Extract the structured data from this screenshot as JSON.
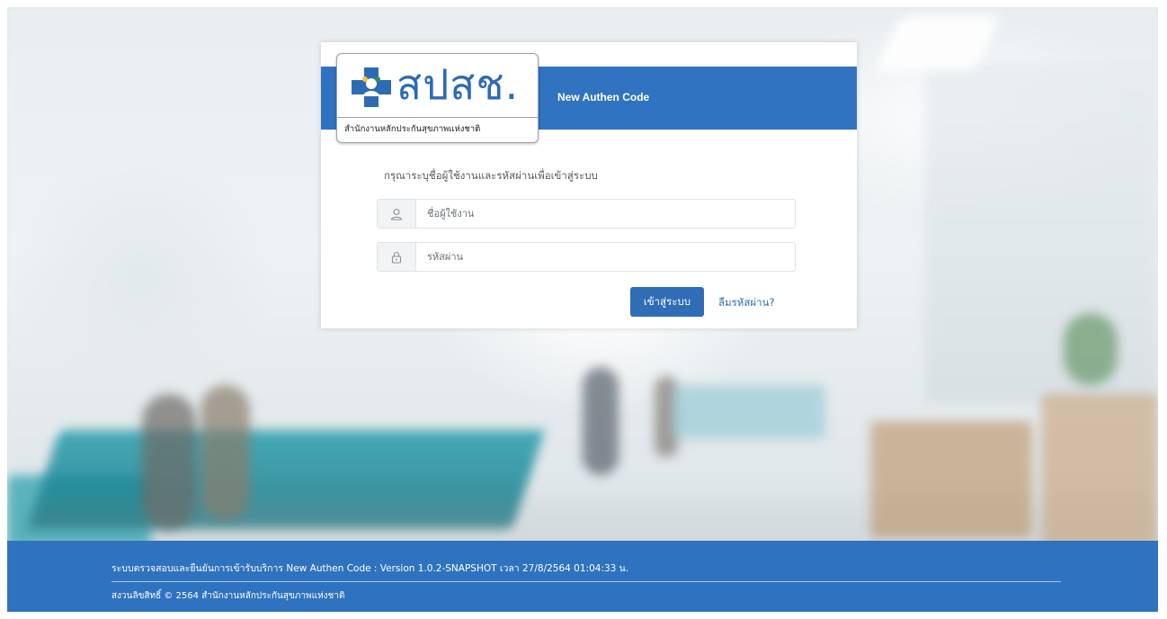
{
  "header": {
    "title": "New Authen Code"
  },
  "logo": {
    "wordmark": "สปสช.",
    "subtitle": "สำนักงานหลักประกันสุขภาพแห่งชาติ",
    "icon": "nhso-cross-icon",
    "brand_color": "#2d6bb5"
  },
  "login": {
    "prompt": "กรุณาระบุชื่อผู้ใช้งานและรหัสผ่านเพื่อเข้าสู่ระบบ",
    "username": {
      "placeholder": "ชื่อผู้ใช้งาน",
      "value": "",
      "icon": "user-icon"
    },
    "password": {
      "placeholder": "รหัสผ่าน",
      "value": "",
      "icon": "lock-icon"
    },
    "submit_label": "เข้าสู่ระบบ",
    "forgot_label": "ลืมรหัสผ่าน?"
  },
  "footer": {
    "line1": "ระบบตรวจสอบและยืนยันการเข้ารับบริการ New Authen Code : Version 1.0.2-SNAPSHOT เวลา 27/8/2564 01:04:33 น.",
    "line2": "สงวนลิขสิทธิ์ © 2564 สำนักงานหลักประกันสุขภาพแห่งชาติ"
  },
  "colors": {
    "primary": "#2f6db7",
    "header_bar": "#3073c0",
    "footer": "#2f72bf"
  }
}
